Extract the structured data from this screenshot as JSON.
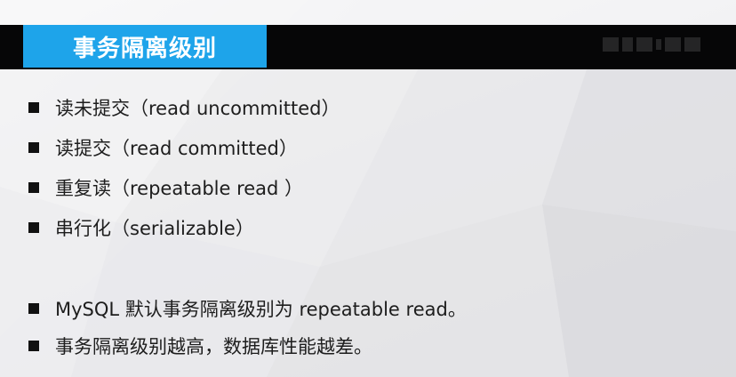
{
  "slide": {
    "title": "事务隔离级别",
    "isolation_levels": [
      "读未提交（read uncommitted）",
      "读提交（read committed）",
      "重复读（repeatable read ）",
      "串行化（serializable）"
    ],
    "notes": [
      "MySQL 默认事务隔离级别为 repeatable read。",
      "事务隔离级别越高，数据库性能越差。"
    ]
  },
  "colors": {
    "title_bar": "#060607",
    "title_accent": "#1ea4ea",
    "title_text": "#ffffff",
    "body_text": "#1d1d1d",
    "bullet": "#111111"
  },
  "icons": {
    "bullet": "square-bullet-icon",
    "watermark": "watermark-logo"
  }
}
